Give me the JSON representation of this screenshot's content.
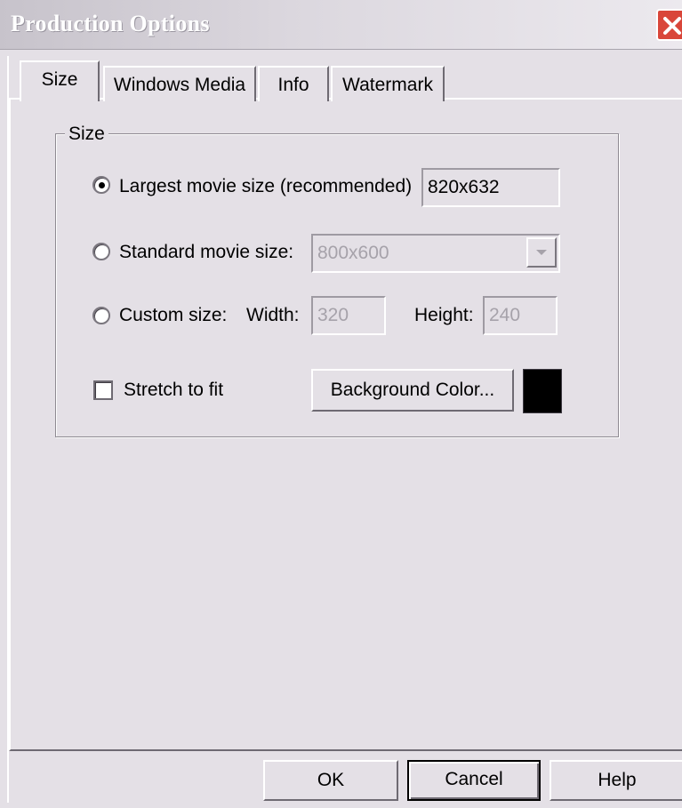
{
  "window": {
    "title": "Production Options"
  },
  "tabs": [
    {
      "label": "Size",
      "active": true
    },
    {
      "label": "Windows Media",
      "active": false
    },
    {
      "label": "Info",
      "active": false
    },
    {
      "label": "Watermark",
      "active": false
    }
  ],
  "size_group": {
    "label": "Size",
    "largest": {
      "label": "Largest movie size (recommended)",
      "selected": true,
      "value": "820x632"
    },
    "standard": {
      "label": "Standard movie size:",
      "selected": false,
      "value": "800x600"
    },
    "custom": {
      "label": "Custom size:",
      "selected": false,
      "width_label": "Width:",
      "width_value": "320",
      "height_label": "Height:",
      "height_value": "240"
    },
    "stretch": {
      "label": "Stretch to fit",
      "checked": false
    },
    "background_button": "Background Color...",
    "background_color": "#000000"
  },
  "buttons": {
    "ok": "OK",
    "cancel": "Cancel",
    "help": "Help"
  },
  "icons": {
    "close": "close-icon",
    "dropdown": "chevron-down-icon"
  }
}
